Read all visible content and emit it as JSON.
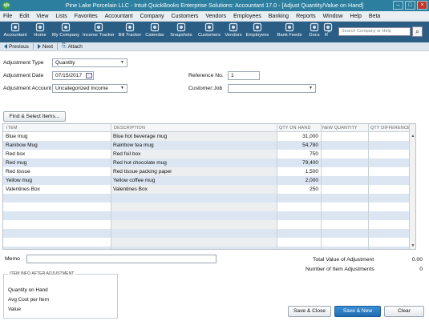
{
  "window": {
    "title": "Pine Lake Porcelain LLC  -  Intuit QuickBooks Enterprise Solutions: Accountant 17.0 - [Adjust Quantity/Value on Hand]",
    "app_icon": "qb",
    "buttons": [
      "–",
      "□",
      "×"
    ]
  },
  "menu": [
    "File",
    "Edit",
    "View",
    "Lists",
    "Favorites",
    "Accountant",
    "Company",
    "Customers",
    "Vendors",
    "Employees",
    "Banking",
    "Reports",
    "Window",
    "Help",
    "Beta"
  ],
  "toolbar": {
    "items": [
      {
        "label": "Accountant",
        "icon": "accountant-icon"
      },
      {
        "label": "Home",
        "icon": "home-icon"
      },
      {
        "label": "My Company",
        "icon": "company-icon"
      },
      {
        "label": "Income Tracker",
        "icon": "income-icon"
      },
      {
        "label": "Bill Tracker",
        "icon": "bill-icon"
      },
      {
        "label": "Calendar",
        "icon": "calendar-icon"
      },
      {
        "label": "Snapshots",
        "icon": "snapshots-icon"
      },
      {
        "label": "Customers",
        "icon": "customers-icon"
      },
      {
        "label": "Vendors",
        "icon": "vendors-icon"
      },
      {
        "label": "Employees",
        "icon": "employees-icon"
      },
      {
        "label": "Bank Feeds",
        "icon": "bankfeeds-icon"
      },
      {
        "label": "Docs",
        "icon": "docs-icon"
      },
      {
        "label": "R",
        "icon": "reports-icon"
      }
    ],
    "search_placeholder": "Search Company or Help",
    "more_glyph": "»"
  },
  "nav": {
    "previous": "Previous",
    "next": "Next",
    "attach": "Attach"
  },
  "form": {
    "adjustment_type_label": "Adjustment Type",
    "adjustment_type_value": "Quantity",
    "adjustment_date_label": "Adjustment Date",
    "adjustment_date_value": "07/15/2017",
    "adjustment_account_label": "Adjustment Account",
    "adjustment_account_value": "Uncategorized Income",
    "reference_label": "Reference No.",
    "reference_value": "1",
    "customer_job_label": "Customer:Job",
    "customer_job_value": "",
    "find_select_label": "Find & Select Items..."
  },
  "table": {
    "headers": [
      "ITEM",
      "DESCRIPTION",
      "QTY ON HAND",
      "NEW QUANTITY",
      "QTY DIFFERENCE"
    ],
    "rows": [
      {
        "item": "Blue mug",
        "description": "Blue hot beverage mug",
        "qty": "31,000",
        "new": "",
        "diff": ""
      },
      {
        "item": "Rainbow Mug",
        "description": "Rainbow tea mug",
        "qty": "54,780",
        "new": "",
        "diff": ""
      },
      {
        "item": "Red box",
        "description": "Red foil box",
        "qty": "750",
        "new": "",
        "diff": ""
      },
      {
        "item": "Red mug",
        "description": "Red hot chocolate mug",
        "qty": "79,400",
        "new": "",
        "diff": ""
      },
      {
        "item": "Red tissue",
        "description": "Red tissue packing paper",
        "qty": "1,500",
        "new": "",
        "diff": ""
      },
      {
        "item": "Yellow mug",
        "description": "Yellow coffee mug",
        "qty": "2,000",
        "new": "",
        "diff": ""
      },
      {
        "item": "Valentines Box",
        "description": "Valentines Box",
        "qty": "250",
        "new": "",
        "diff": ""
      },
      {
        "item": "",
        "description": "",
        "qty": "",
        "new": "",
        "diff": ""
      },
      {
        "item": "",
        "description": "",
        "qty": "",
        "new": "",
        "diff": ""
      },
      {
        "item": "",
        "description": "",
        "qty": "",
        "new": "",
        "diff": ""
      },
      {
        "item": "",
        "description": "",
        "qty": "",
        "new": "",
        "diff": ""
      },
      {
        "item": "",
        "description": "",
        "qty": "",
        "new": "",
        "diff": ""
      },
      {
        "item": "",
        "description": "",
        "qty": "",
        "new": "",
        "diff": ""
      },
      {
        "item": "",
        "description": "",
        "qty": "",
        "new": "",
        "diff": ""
      }
    ]
  },
  "footer": {
    "memo_label": "Memo",
    "memo_value": "",
    "total_value_label": "Total Value of Adjustment",
    "total_value": "0.00",
    "num_adjustments_label": "Number of Item Adjustments",
    "num_adjustments": "0",
    "info_header": "ITEM INFO AFTER ADJUSTMENT",
    "info_labels": [
      "Quantity on Hand",
      "Avg Cost per Item",
      "Value"
    ],
    "save_close": "Save & Close",
    "save_new": "Save & New",
    "clear": "Clear"
  },
  "colors": {
    "titlebar": "#2d7fa0",
    "toolbar": "#2b5e85",
    "row_alt": "#dbe6f2",
    "primary_button": "#1f6bb0"
  }
}
